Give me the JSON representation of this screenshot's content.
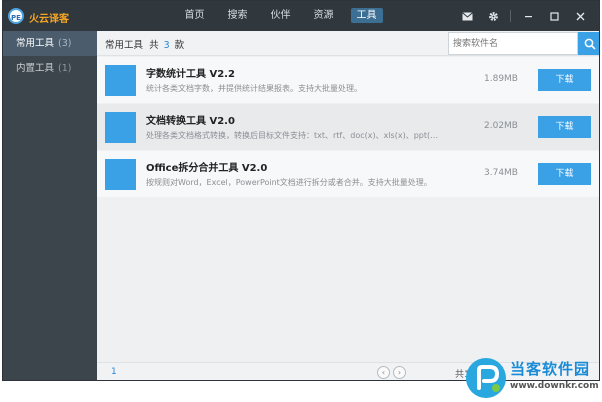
{
  "app": {
    "logo_text": "PE",
    "name": "火云译客"
  },
  "nav": {
    "items": [
      {
        "label": "首页"
      },
      {
        "label": "搜索"
      },
      {
        "label": "伙伴"
      },
      {
        "label": "资源"
      },
      {
        "label": "工具"
      }
    ],
    "active": "工具"
  },
  "window_controls": {
    "icons": [
      "mail-icon",
      "gear-icon",
      "minimize-icon",
      "maximize-icon",
      "close-icon"
    ]
  },
  "sidebar": {
    "items": [
      {
        "label": "常用工具",
        "count": "(3)"
      },
      {
        "label": "内置工具",
        "count": "(1)"
      }
    ]
  },
  "header": {
    "label_prefix": "常用工具",
    "label_total": "共",
    "count": "3",
    "unit": "款",
    "search_placeholder": "搜索软件名"
  },
  "tools": [
    {
      "name": "字数统计工具 V2.2",
      "desc": "统计各类文档字数，并提供统计结果报表。支持大批量处理。",
      "size": "1.89MB",
      "button": "下载"
    },
    {
      "name": "文档转换工具 V2.0",
      "desc": "处理各类文档格式转换，转换后目标文件支持：txt、rtf、doc(x)、xls(x)、ppt(x...",
      "size": "2.02MB",
      "button": "下载"
    },
    {
      "name": "Office拆分合并工具 V2.0",
      "desc": "按规则对Word，Excel，PowerPoint文档进行拆分或者合并。支持大批量处理。",
      "size": "3.74MB",
      "button": "下载"
    }
  ],
  "footer": {
    "page": "1",
    "total": "共1"
  },
  "watermark": {
    "text": "当客软件园",
    "url": "www.downkr.com"
  },
  "colors": {
    "titlebar": "#30373d",
    "sidebar": "#3d454c",
    "accent": "#3aa1e6"
  }
}
